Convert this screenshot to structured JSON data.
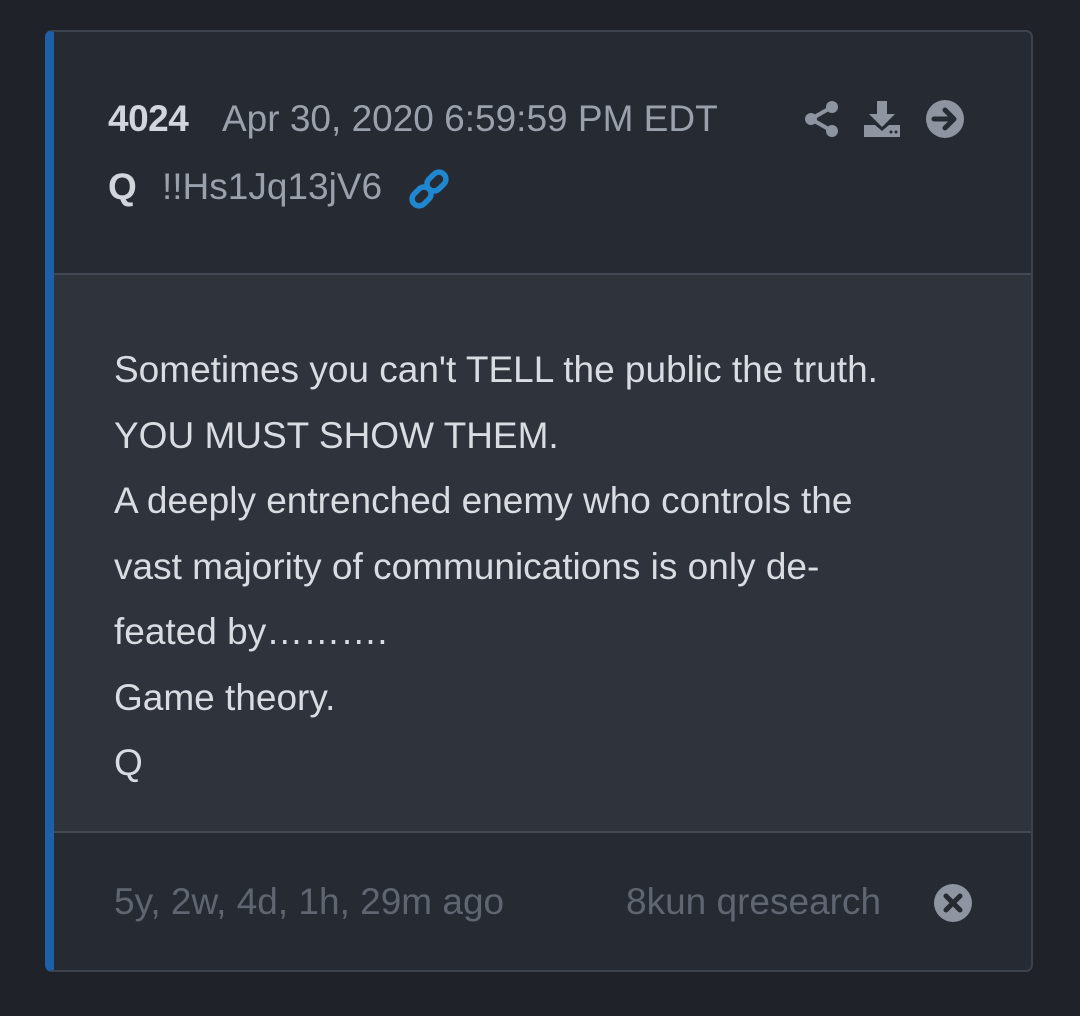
{
  "post": {
    "number": "4024",
    "date": "Apr 30, 2020 6:59:59 PM EDT",
    "author": "Q",
    "tripcode": "!!Hs1Jq13jV6",
    "body_lines": [
      "Sometimes you can't TELL the public the truth.",
      "YOU MUST SHOW THEM.",
      "A deeply entrenched enemy who controls the",
      "vast majority of communications is only de-",
      "feated by……….",
      "Game theory.",
      "Q"
    ],
    "age": "5y, 2w, 4d, 1h, 29m ago",
    "source": "8kun qresearch"
  },
  "icons": {
    "share": "share-icon",
    "download": "download-icon",
    "forward": "arrow-right-circle-icon",
    "link": "link-icon",
    "close": "close-circle-icon"
  },
  "colors": {
    "page_background": "#1f2229",
    "card_background": "#262a32",
    "body_background": "#2e333c",
    "accent_border": "#1f5ea8",
    "link_icon": "#1f86d0",
    "muted_text": "#5f6671"
  }
}
